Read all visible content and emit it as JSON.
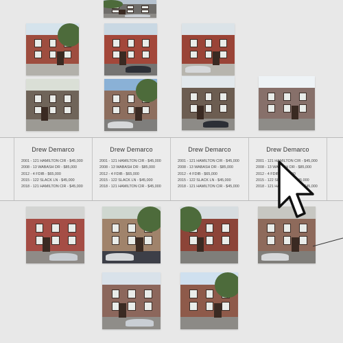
{
  "screen": {
    "background": "#e8e8e8",
    "photos": [
      {
        "id": "photo-top",
        "sky": "#b6c2cf",
        "wall": "#6f6d6a",
        "street": "#8c8a86"
      },
      {
        "id": "photo-r1c1",
        "sky": "#d5e3ec",
        "wall": "#9e4d3f",
        "street": "#b2b0aa"
      },
      {
        "id": "photo-r1c2",
        "sky": "#c9d8e3",
        "wall": "#a3473a",
        "street": "#757472"
      },
      {
        "id": "photo-r1c3",
        "sky": "#dbe3e8",
        "wall": "#9a4437",
        "street": "#b7b5ae"
      },
      {
        "id": "photo-r2c1",
        "sky": "#dadfd6",
        "wall": "#6f6459",
        "street": "#9c9a94"
      },
      {
        "id": "photo-r2c2",
        "sky": "#8ab1d6",
        "wall": "#8d6e5e",
        "street": "#7f7e7c"
      },
      {
        "id": "photo-r2c3",
        "sky": "#e2e8ec",
        "wall": "#6c5d51",
        "street": "#8d8b87"
      },
      {
        "id": "photo-r2c4",
        "sky": "#eef3f6",
        "wall": "#87706a",
        "street": "#8e8c88"
      },
      {
        "id": "photo-r3c1",
        "sky": "#d3d4d2",
        "wall": "#a54d45",
        "street": "#8f8b87"
      },
      {
        "id": "photo-r3c2",
        "sky": "#cfd7d0",
        "wall": "#a0836b",
        "street": "#3d3f48"
      },
      {
        "id": "photo-r3c3",
        "sky": "#d7dde0",
        "wall": "#8c4438",
        "street": "#7f7e7a"
      },
      {
        "id": "photo-r3c4",
        "sky": "#c7c7c2",
        "wall": "#8e6a5b",
        "street": "#807e7a"
      },
      {
        "id": "photo-r4c1",
        "sky": "#d9e2ea",
        "wall": "#8c675c",
        "street": "#8f8d89"
      },
      {
        "id": "photo-r4c2",
        "sky": "#cfe0ef",
        "wall": "#8e5a4a",
        "street": "#8c8a86"
      }
    ],
    "cards": [
      {
        "name": "Drew Demarco",
        "lines": [
          "2001 - 121 HAMILTON CIR - $45,000",
          "2008 - 13 WABASH DR - $85,000",
          "2012 - 4 FDIB - $65,000",
          "2015 - 122 SLACK LN - $45,000",
          "2018 - 121 HAMILTON CIR - $45,000"
        ]
      },
      {
        "name": "Drew Demarco",
        "lines": [
          "2001 - 121 HAMILTON CIR - $45,000",
          "2008 - 13 WABASH DR - $85,000",
          "2012 - 4 FDIB - $65,000",
          "2015 - 122 SLACK LN - $45,000",
          "2018 - 121 HAMILTON CIR - $45,000"
        ]
      },
      {
        "name": "Drew Demarco",
        "lines": [
          "2001 - 121 HAMILTON CIR - $45,000",
          "2008 - 13 WABASH DR - $85,000",
          "2012 - 4 FDIB - $65,000",
          "2015 - 122 SLACK LN - $45,000",
          "2018 - 121 HAMILTON CIR - $45,000"
        ]
      },
      {
        "name": "Drew Demarco",
        "lines": [
          "2001 - 121 HAMILTON CIR - $45,000",
          "2008 - 13 WABASH DR - $85,000",
          "2012 - 4 FDIB - $65,000",
          "2015 - 122 SLACK LN - $45,000",
          "2018 - 121 HAMILTON CIR - $45,000"
        ]
      }
    ],
    "cursor": {
      "icon": "arrow-cursor-icon",
      "fill": "#ffffff",
      "stroke": "#111111"
    }
  }
}
